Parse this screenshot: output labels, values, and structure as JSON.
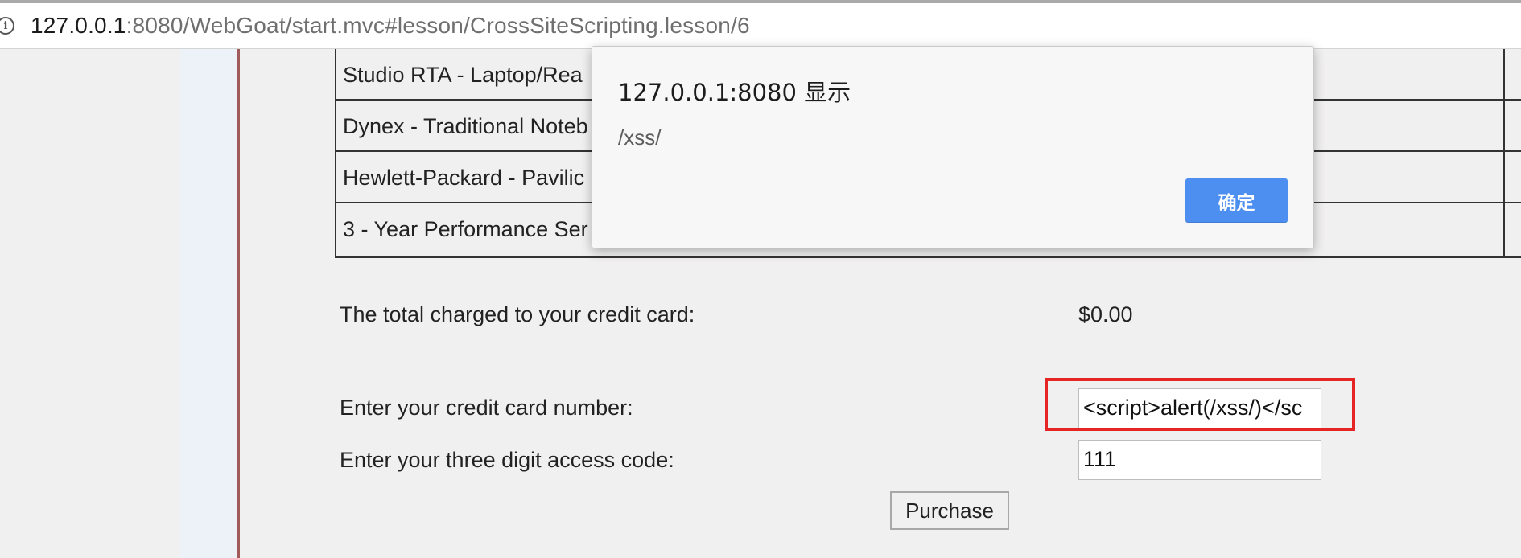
{
  "browser": {
    "url_host": "127.0.0.1",
    "url_rest": ":8080/WebGoat/start.mvc#lesson/CrossSiteScripting.lesson/6"
  },
  "table": {
    "rows": [
      "Studio RTA - Laptop/Rea",
      "Dynex - Traditional Noteb",
      "Hewlett-Packard - Pavilic",
      "3 - Year Performance Ser"
    ]
  },
  "form": {
    "total_label": "The total charged to your credit card:",
    "total_value": "$0.00",
    "cc_label": "Enter your credit card number:",
    "cc_value": "<script>alert(/xss/)</sc",
    "code_label": "Enter your three digit access code:",
    "code_value": "111",
    "purchase_label": "Purchase"
  },
  "dialog": {
    "title": "127.0.0.1:8080 显示",
    "message": "/xss/",
    "ok_label": "确定"
  },
  "colors": {
    "highlight_box": "#e52424",
    "ok_button": "#4c8ff0",
    "nav_border": "#a15b5b"
  }
}
